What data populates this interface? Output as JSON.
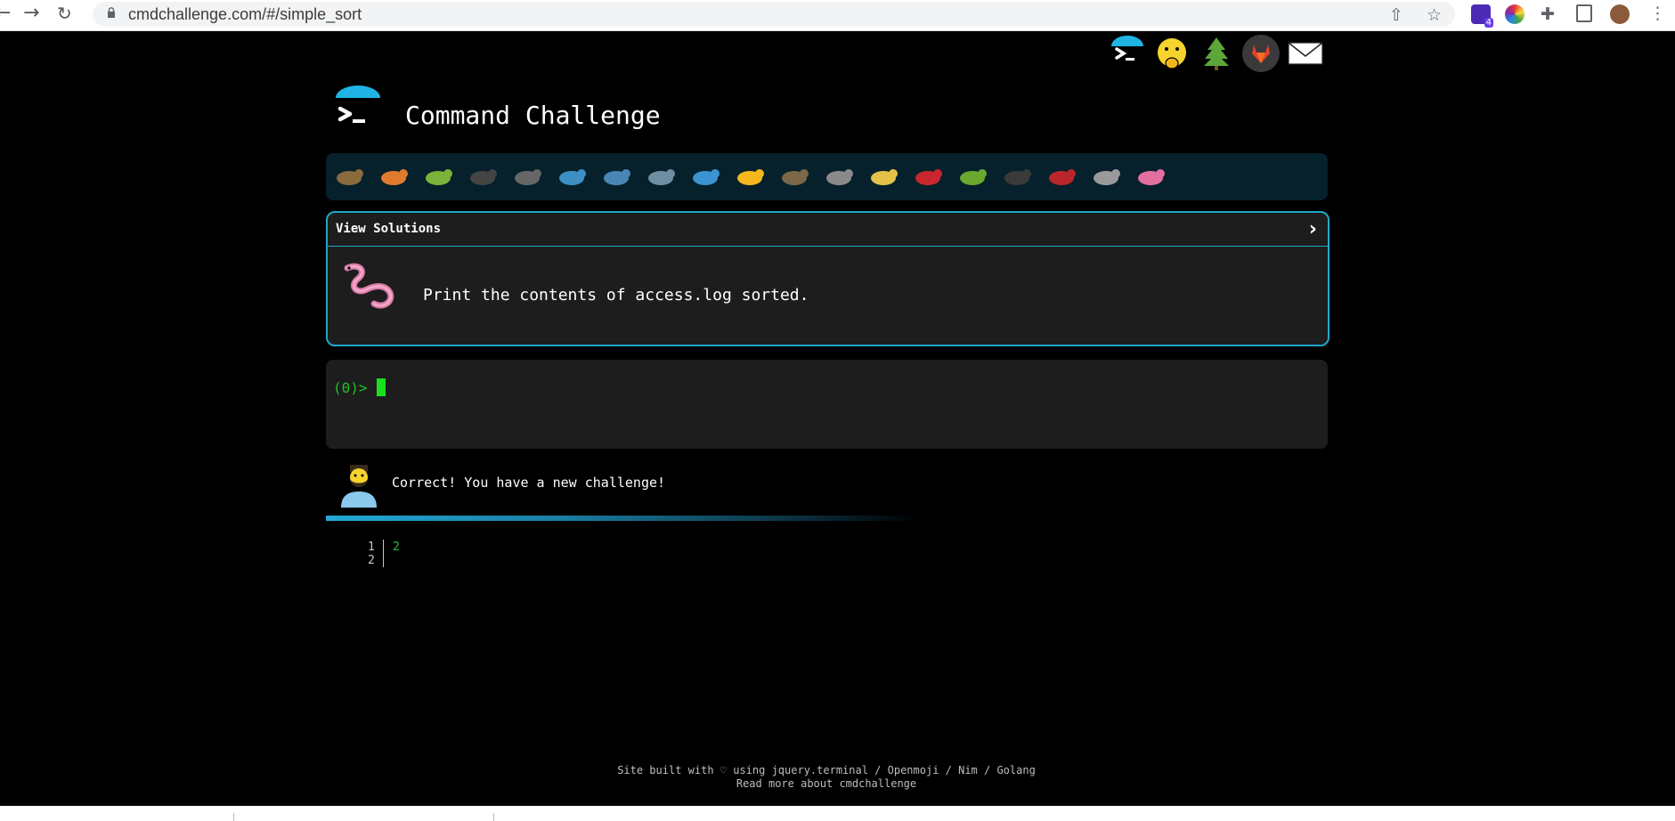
{
  "browser": {
    "url": "cmdchallenge.com/#/simple_sort",
    "extension_badge": "4"
  },
  "header": {
    "title": "Command Challenge"
  },
  "top_icons": [
    "terminal-icon",
    "face-hand-over-mouth-icon",
    "tree-icon",
    "gitlab-icon",
    "mail-icon"
  ],
  "challenges": [
    {
      "name": "snail-icon",
      "color": "#8b6a3e"
    },
    {
      "name": "butterfly-icon",
      "color": "#e07a2f"
    },
    {
      "name": "caterpillar-icon",
      "color": "#7bb33a"
    },
    {
      "name": "ant-icon",
      "color": "#444444"
    },
    {
      "name": "spider-web-icon",
      "color": "#666666"
    },
    {
      "name": "whale-icon",
      "color": "#3d8fc4"
    },
    {
      "name": "shark-icon",
      "color": "#4a86b5"
    },
    {
      "name": "dolphin-icon",
      "color": "#6e8fa3"
    },
    {
      "name": "fish-icon",
      "color": "#3b93d1"
    },
    {
      "name": "tropical-fish-icon",
      "color": "#f2b81d"
    },
    {
      "name": "blowfish-icon",
      "color": "#7a6848"
    },
    {
      "name": "wolf-icon",
      "color": "#8a8a8a"
    },
    {
      "name": "bee-icon",
      "color": "#e4c24a"
    },
    {
      "name": "ladybug-icon",
      "color": "#c9272d"
    },
    {
      "name": "cricket-icon",
      "color": "#6aa82f"
    },
    {
      "name": "spider-icon",
      "color": "#3a3a3a"
    },
    {
      "name": "scorpion-icon",
      "color": "#b8262b"
    },
    {
      "name": "fly-icon",
      "color": "#9a9a9a"
    },
    {
      "name": "worm-icon",
      "color": "#e36fa0"
    }
  ],
  "task": {
    "view_solutions": "View Solutions",
    "chevron": "›",
    "description": "Print the contents of access.log sorted."
  },
  "terminal": {
    "prompt": "(0)>"
  },
  "feedback": {
    "message": "Correct! You have a new challenge!"
  },
  "output": {
    "line_numbers": [
      "1",
      "2"
    ],
    "lines": [
      "2",
      ""
    ]
  },
  "footer": {
    "line1": "Site built with ♡ using jquery.terminal / Openmoji / Nim / Golang",
    "line2": "Read more about cmdchallenge"
  },
  "colors": {
    "accent": "#1fa7c9",
    "terminal_green": "#22c22a",
    "panel_bg": "#1d1d1d",
    "strip_bg": "#06212b"
  }
}
